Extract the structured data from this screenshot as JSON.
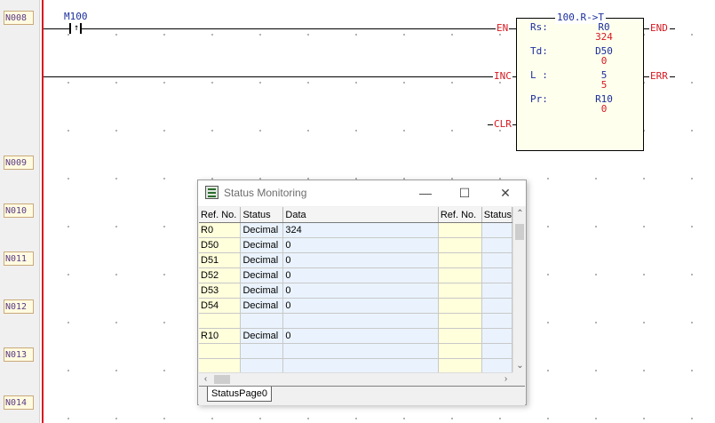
{
  "ladder": {
    "networks": [
      "N008",
      "N009",
      "N010",
      "N011",
      "N012",
      "N013",
      "N014"
    ],
    "contact": {
      "name": "M100",
      "type": "rising-edge contact"
    },
    "function_block": {
      "title": "100.R->T",
      "inputs": [
        "EN",
        "INC",
        "CLR"
      ],
      "outputs": [
        "END",
        "ERR"
      ],
      "params": [
        {
          "label": "Rs:",
          "ref": "R0",
          "value": "324"
        },
        {
          "label": "Td:",
          "ref": "D50",
          "value": "0"
        },
        {
          "label": "L :",
          "ref": "5",
          "value": "5"
        },
        {
          "label": "Pr:",
          "ref": "R10",
          "value": "0"
        }
      ]
    },
    "colors": {
      "rail": "#d71921",
      "label_text": "#1a2e9c",
      "value_text": "#d71921",
      "network_text": "#5b3a86"
    }
  },
  "status_window": {
    "title": "Status Monitoring",
    "icon": "monitor-icon",
    "buttons": {
      "minimize": "—",
      "maximize": "☐",
      "close": "✕"
    },
    "columns": [
      "Ref. No.",
      "Status",
      "Data",
      "Ref. No.",
      "Status"
    ],
    "rows": [
      [
        "R0",
        "Decimal",
        "324",
        "",
        ""
      ],
      [
        "D50",
        "Decimal",
        "0",
        "",
        ""
      ],
      [
        "D51",
        "Decimal",
        "0",
        "",
        ""
      ],
      [
        "D52",
        "Decimal",
        "0",
        "",
        ""
      ],
      [
        "D53",
        "Decimal",
        "0",
        "",
        ""
      ],
      [
        "D54",
        "Decimal",
        "0",
        "",
        ""
      ],
      [
        "",
        "",
        "",
        "",
        ""
      ],
      [
        "R10",
        "Decimal",
        "0",
        "",
        ""
      ],
      [
        "",
        "",
        "",
        "",
        ""
      ],
      [
        "",
        "",
        "",
        "",
        ""
      ]
    ],
    "tabs": [
      "StatusPage0"
    ]
  }
}
